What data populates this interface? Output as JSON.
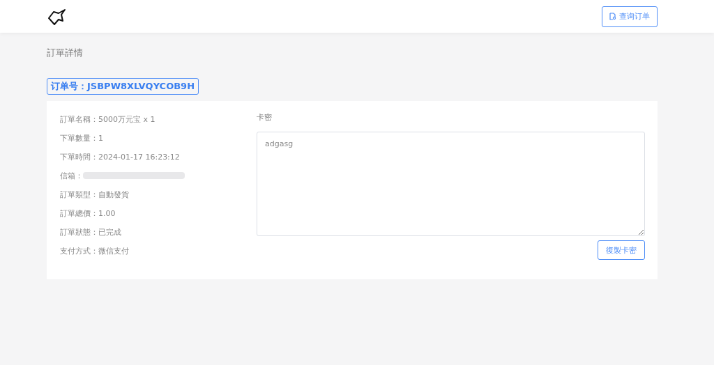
{
  "header": {
    "button": "查询订单"
  },
  "page_title": "訂單詳情",
  "order_number": "订单号：JSBPW8XLVQYCOB9H",
  "details": [
    {
      "kind": "text",
      "label": "訂單名稱：",
      "value": "5000万元宝 x 1"
    },
    {
      "kind": "text",
      "label": "下單數量：",
      "value": "1"
    },
    {
      "kind": "text",
      "label": "下單時間：",
      "value": "2024-01-17 16:23:12"
    },
    {
      "kind": "redacted",
      "label": "信箱："
    },
    {
      "kind": "text",
      "label": "訂單類型：",
      "value": "自動發貨"
    },
    {
      "kind": "text",
      "label": "訂單總價：",
      "value": "1.00"
    },
    {
      "kind": "text",
      "label": "訂單狀態：",
      "value": "已完成"
    },
    {
      "kind": "text",
      "label": "支付方式：",
      "value": "微信支付"
    }
  ],
  "card_key": {
    "label": "卡密",
    "value": "adgasg",
    "button": "復製卡密"
  }
}
